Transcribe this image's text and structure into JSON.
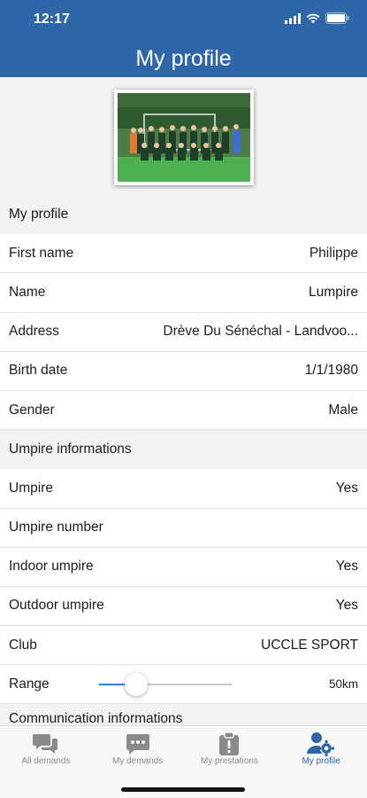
{
  "status": {
    "time": "12:17"
  },
  "header": {
    "title": "My profile"
  },
  "profile_section": {
    "title": "My profile",
    "rows": [
      {
        "label": "First name",
        "value": "Philippe"
      },
      {
        "label": "Name",
        "value": "Lumpire"
      },
      {
        "label": "Address",
        "value": "Drève Du Sénéchal - Landvoo..."
      },
      {
        "label": "Birth date",
        "value": "1/1/1980"
      },
      {
        "label": "Gender",
        "value": "Male"
      }
    ]
  },
  "umpire_section": {
    "title": "Umpire informations",
    "rows": [
      {
        "label": "Umpire",
        "value": "Yes"
      },
      {
        "label": "Umpire number",
        "value": ""
      },
      {
        "label": "Indoor umpire",
        "value": "Yes"
      },
      {
        "label": "Outdoor umpire",
        "value": "Yes"
      },
      {
        "label": "Club",
        "value": "UCCLE SPORT"
      }
    ],
    "range": {
      "label": "Range",
      "value": "50km",
      "slider_fraction": 0.28
    }
  },
  "communication_section": {
    "title": "Communication informations"
  },
  "tabbar": {
    "tabs": [
      {
        "label": "All demands",
        "icon": "chat-bubbles-icon"
      },
      {
        "label": "My demands",
        "icon": "chat-dots-icon"
      },
      {
        "label": "My prestations",
        "icon": "clipboard-alert-icon"
      },
      {
        "label": "My profile",
        "icon": "user-gear-icon"
      }
    ],
    "active_index": 3
  },
  "colors": {
    "header": "#2e66a8",
    "accent": "#2f7be8",
    "inactive": "#8a8a8a"
  }
}
